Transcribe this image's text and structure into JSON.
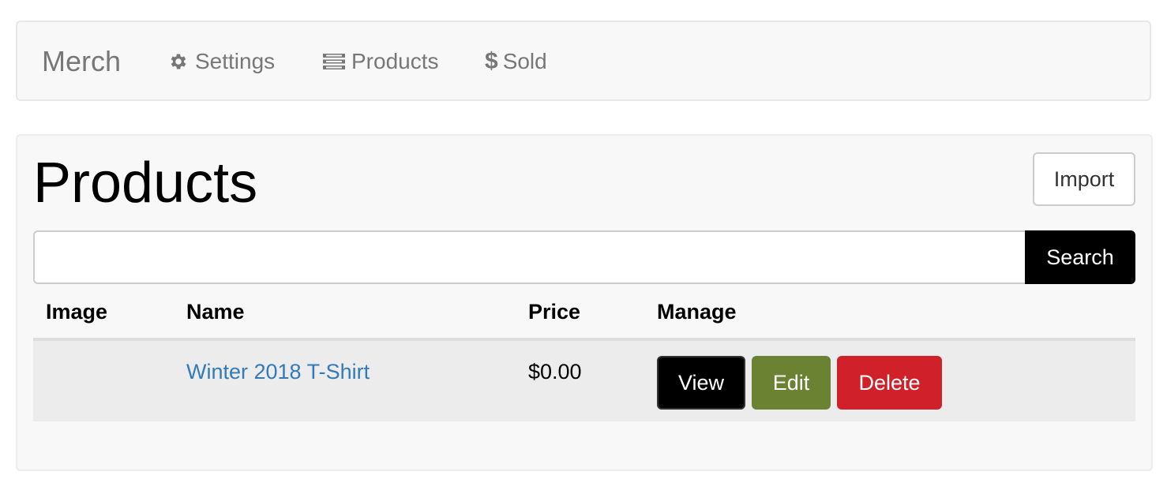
{
  "navbar": {
    "brand": "Merch",
    "items": [
      {
        "label": "Settings",
        "icon": "gear-icon"
      },
      {
        "label": "Products",
        "icon": "list-icon"
      },
      {
        "label": "Sold",
        "icon": "dollar-icon"
      }
    ]
  },
  "main": {
    "title": "Products",
    "import_label": "Import",
    "search": {
      "value": "",
      "placeholder": "",
      "button_label": "Search"
    },
    "table": {
      "columns": [
        "Image",
        "Name",
        "Price",
        "Manage"
      ],
      "rows": [
        {
          "image": "",
          "name": "Winter 2018 T-Shirt",
          "price": "$0.00",
          "actions": [
            "View",
            "Edit",
            "Delete"
          ]
        }
      ]
    }
  },
  "colors": {
    "link": "#337ab7",
    "view_button": "#000000",
    "edit_button": "#6b8233",
    "delete_button": "#d0202a"
  }
}
